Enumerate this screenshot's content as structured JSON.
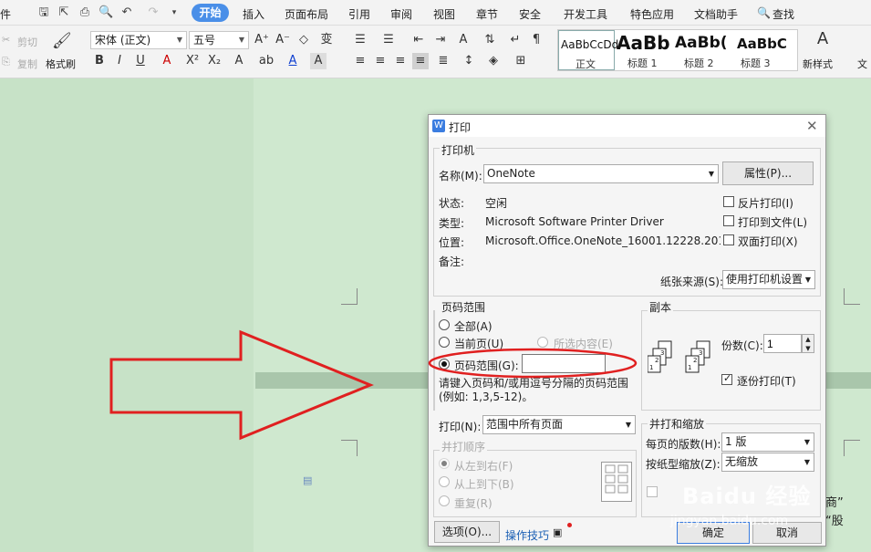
{
  "menubar": {
    "file_tail": "件",
    "tabs": [
      "开始",
      "插入",
      "页面布局",
      "引用",
      "审阅",
      "视图",
      "章节",
      "安全",
      "开发工具",
      "特色应用",
      "文档助手"
    ],
    "search": "查找"
  },
  "ribbon": {
    "cut": "剪切",
    "copy": "复制",
    "format_painter": "格式刷",
    "font_name": "宋体 (正文)",
    "font_size": "五号",
    "styles": [
      {
        "sample": "AaBbCcDd",
        "label": "正文"
      },
      {
        "sample": "AaBb",
        "label": "标题 1"
      },
      {
        "sample": "AaBb(",
        "label": "标题 2"
      },
      {
        "sample": "AaBbC",
        "label": "标题 3"
      }
    ],
    "new_style": "新样式",
    "doc_tail": "文"
  },
  "dialog": {
    "title": "打印",
    "printer_group": "打印机",
    "name_label": "名称(M):",
    "name_value": "OneNote",
    "properties": "属性(P)...",
    "status_label": "状态:",
    "status_value": "空闲",
    "type_label": "类型:",
    "type_value": "Microsoft Software Printer Driver",
    "where_label": "位置:",
    "where_value": "Microsoft.Office.OneNote_16001.12228.20184",
    "comment_label": "备注:",
    "reverse_print": "反片打印(I)",
    "print_to_file": "打印到文件(L)",
    "duplex": "双面打印(X)",
    "paper_source_label": "纸张来源(S):",
    "paper_source_value": "使用打印机设置",
    "range_group": "页码范围",
    "all": "全部(A)",
    "current": "当前页(U)",
    "selection": "所选内容(E)",
    "pages": "页码范围(G):",
    "pages_value": "",
    "hint": "请键入页码和/或用逗号分隔的页码范围 (例如: 1,3,5-12)。",
    "copies_group": "副本",
    "copies_label": "份数(C):",
    "copies_value": "1",
    "collate": "逐份打印(T)",
    "print_label": "打印(N):",
    "print_value": "范围中所有页面",
    "order_group": "并打顺序",
    "left_right": "从左到右(F)",
    "top_bottom": "从上到下(B)",
    "repeat": "重复(R)",
    "zoom_group": "并打和缩放",
    "per_page_label": "每页的版数(H):",
    "per_page_value": "1 版",
    "scale_label": "按纸型缩放(Z):",
    "scale_value": "无缩放",
    "options": "选项(O)...",
    "tips": "操作技巧",
    "ok": "确定",
    "cancel": "取消"
  },
  "doc": {
    "text1": "商”",
    "text2": "“股"
  },
  "watermark": {
    "brand": "Baidu 经验",
    "url": "jingyan.baidu.com"
  },
  "colors": {
    "accent": "#4a8fe8",
    "annotation": "#e02020"
  }
}
